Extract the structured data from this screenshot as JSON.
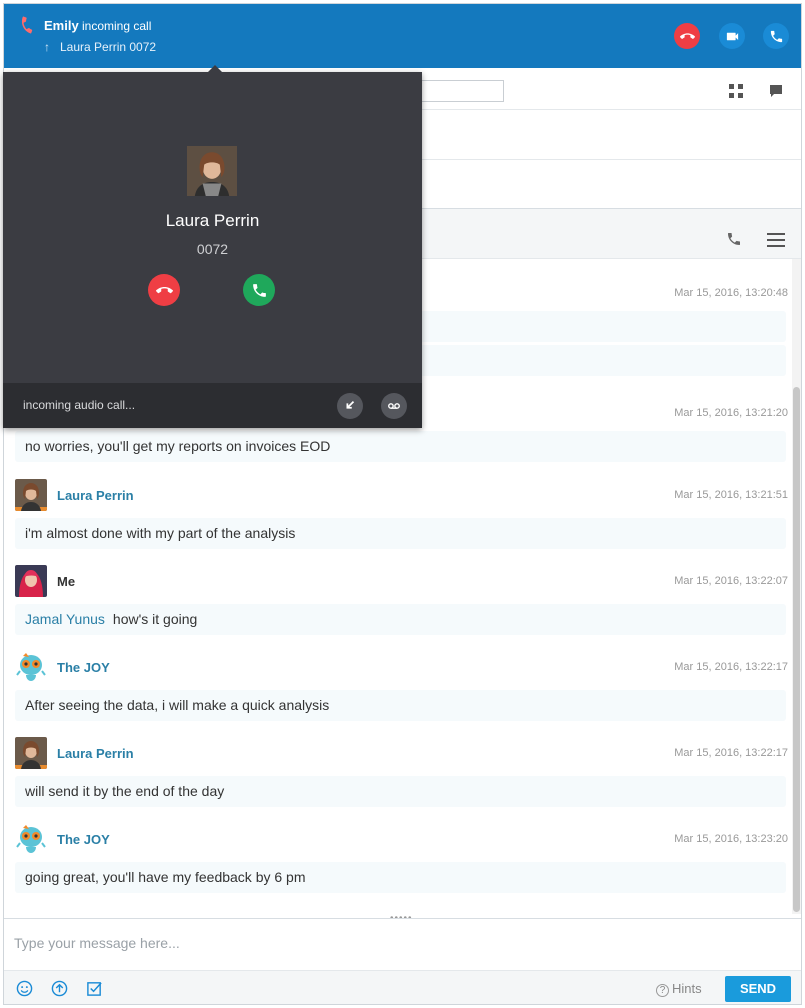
{
  "top_bar": {
    "caller": "Emily",
    "status": "incoming call",
    "sub_line": "Laura Perrin  0072",
    "sub_icon": "↑"
  },
  "popup": {
    "name": "Laura Perrin",
    "extension": "0072",
    "footer_text": "incoming audio call..."
  },
  "messages": [
    {
      "author": "",
      "timestamp": "Mar 15, 2016, 13:20:48",
      "texts": [
        "",
        ""
      ]
    },
    {
      "author": "",
      "timestamp": "Mar 15, 2016, 13:21:20",
      "texts": [
        "no worries, you'll get my reports on invoices EOD"
      ]
    },
    {
      "author": "Laura Perrin",
      "timestamp": "Mar 15, 2016, 13:21:51",
      "texts": [
        "i'm almost done with my part of the analysis"
      ]
    },
    {
      "author": "Me",
      "timestamp": "Mar 15, 2016, 13:22:07",
      "mention": "Jamal Yunus",
      "texts": [
        "how's it going"
      ]
    },
    {
      "author": "The JOY",
      "timestamp": "Mar 15, 2016, 13:22:17",
      "texts": [
        "After seeing  the data, i will make a quick analysis"
      ]
    },
    {
      "author": "Laura Perrin",
      "timestamp": "Mar 15, 2016, 13:22:17",
      "texts": [
        "will send it by the end of the day"
      ]
    },
    {
      "author": "The JOY",
      "timestamp": "Mar 15, 2016, 13:23:20",
      "texts": [
        "going great, you'll have my feedback by 6 pm"
      ]
    }
  ],
  "composer": {
    "placeholder": "Type your message here...",
    "hints_label": "Hints",
    "hints_icon": "?",
    "send_label": "SEND"
  },
  "colors": {
    "top_bar": "#1479be",
    "hangup": "#ef3e44",
    "accept": "#1fa85b",
    "popup_bg": "#3b3c42",
    "author_link": "#2a7fa6",
    "send_button": "#1a9bdc"
  },
  "icons": {
    "top_bar": [
      "missed-call-icon",
      "hangup-icon",
      "video-icon",
      "phone-icon"
    ],
    "popup": [
      "decline-icon",
      "accept-icon",
      "deflect-icon",
      "voicemail-icon"
    ],
    "toolbar": [
      "grid-icon",
      "chat-bubble-icon",
      "call-icon",
      "menu-icon"
    ],
    "composer": [
      "emoji-icon",
      "upload-icon",
      "checkbox-icon",
      "help-icon"
    ]
  }
}
